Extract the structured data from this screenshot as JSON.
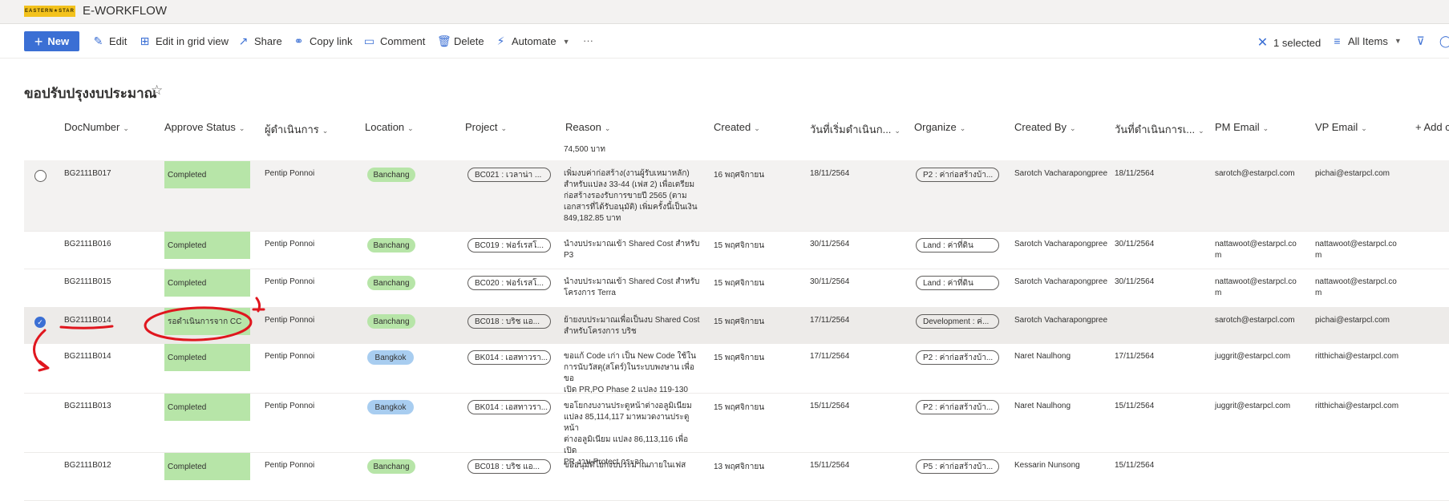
{
  "header": {
    "logo_text": "EASTERN★STAR",
    "app_title": "E-WORKFLOW"
  },
  "command_bar": {
    "new_label": "New",
    "edit_label": "Edit",
    "grid_label": "Edit in grid view",
    "share_label": "Share",
    "copy_link_label": "Copy link",
    "comment_label": "Comment",
    "delete_label": "Delete",
    "automate_label": "Automate",
    "more_label": "···",
    "selected_label": "1 selected",
    "view_label": "All Items"
  },
  "page_title": "ขอปรับปรุงงบประมาณ",
  "columns": [
    "DocNumber",
    "Approve Status",
    "ผู้ดำเนินการ",
    "Location",
    "Project",
    "Reason",
    "Created",
    "วันที่เริ่มดำเนินก...",
    "Organize",
    "Created By",
    "วันที่ดำเนินการเ...",
    "PM Email",
    "VP Email",
    "+ Add c"
  ],
  "top_cut_text": "74,500 บาท",
  "rows": [
    {
      "doc": "BG2111B017",
      "status": "Completed",
      "operator": "Pentip Ponnoi",
      "location": "Banchang",
      "project": "BC021 : เวลาน่า ...",
      "reason": [
        "เพิ่มงบค่าก่อสร้าง(งานผู้รับเหมาหลัก)",
        "สำหรับแปลง 33-44 (เฟส 2) เพื่อเตรียม",
        "ก่อสร้างรองรับการขายปี 2565 (ตาม",
        "เอกสารที่ได้รับอนุมัติ) เพิ่มครั้งนี้เป็นเงิน",
        "849,182.85 บาท"
      ],
      "created": "16 พฤศจิกายน",
      "start_date": "18/11/2564",
      "organize": "P2 : ค่าก่อสร้างบ้า...",
      "created_by": "Sarotch Vacharapongpree",
      "proc_date": "18/11/2564",
      "pm_email": [
        "sarotch@estarpcl.com"
      ],
      "vp_email": [
        "pichai@estarpcl.com"
      ]
    },
    {
      "doc": "BG2111B016",
      "status": "Completed",
      "operator": "Pentip Ponnoi",
      "location": "Banchang",
      "project": "BC019 : ฟอร์เรสโ...",
      "reason": [
        "นำงบประมาณเข้า Shared Cost สำหรับ",
        "P3"
      ],
      "created": "15 พฤศจิกายน",
      "start_date": "30/11/2564",
      "organize": "Land : ค่าที่ดิน",
      "created_by": "Sarotch Vacharapongpree",
      "proc_date": "30/11/2564",
      "pm_email": [
        "nattawoot@estarpcl.co",
        "m"
      ],
      "vp_email": [
        "nattawoot@estarpcl.co",
        "m"
      ]
    },
    {
      "doc": "BG2111B015",
      "status": "Completed",
      "operator": "Pentip Ponnoi",
      "location": "Banchang",
      "project": "BC020 : ฟอร์เรสโ...",
      "reason": [
        "นำงบประมาณเข้า Shared Cost สำหรับ",
        "โครงการ Terra"
      ],
      "created": "15 พฤศจิกายน",
      "start_date": "30/11/2564",
      "organize": "Land : ค่าที่ดิน",
      "created_by": "Sarotch Vacharapongpree",
      "proc_date": "30/11/2564",
      "pm_email": [
        "nattawoot@estarpcl.co",
        "m"
      ],
      "vp_email": [
        "nattawoot@estarpcl.co",
        "m"
      ]
    },
    {
      "doc": "BG2111B014",
      "status": "รอดำเนินการจาก CC",
      "operator": "Pentip Ponnoi",
      "location": "Banchang",
      "project": "BC018 : บริช แอ...",
      "reason": [
        "ย้ายงบประมาณเพื่อเป็นงบ Shared Cost",
        "สำหรับโครงการ บริช"
      ],
      "created": "15 พฤศจิกายน",
      "start_date": "17/11/2564",
      "organize": "Development : ค่...",
      "created_by": "Sarotch Vacharapongpree",
      "proc_date": "",
      "pm_email": [
        "sarotch@estarpcl.com"
      ],
      "vp_email": [
        "pichai@estarpcl.com"
      ]
    },
    {
      "doc": "BG2111B014",
      "status": "Completed",
      "operator": "Pentip Ponnoi",
      "location": "Bangkok",
      "project": "BK014 : เอสทาวรา...",
      "reason": [
        "ขอแก้ Code เก่า เป็น New Code ใช้ใน",
        "การนับวัสดุ(สโตร์)ในระบบพงษาน เพื่อขอ",
        "เปิด PR,PO Phase 2 แปลง 119-130"
      ],
      "created": "15 พฤศจิกายน",
      "start_date": "17/11/2564",
      "organize": "P2 : ค่าก่อสร้างบ้า...",
      "created_by": "Naret Naulhong",
      "proc_date": "17/11/2564",
      "pm_email": [
        "juggrit@estarpcl.com"
      ],
      "vp_email": [
        "ritthichai@estarpcl.com"
      ]
    },
    {
      "doc": "BG2111B013",
      "status": "Completed",
      "operator": "Pentip Ponnoi",
      "location": "Bangkok",
      "project": "BK014 : เอสทาวรา...",
      "reason": [
        "ขอโยกงบงานประตูหน้าต่างอลูมิเนียม",
        "แปลง 85,114,117 มาหมวดงานประตูหน้า",
        "ต่างอลูมิเนียม แปลง 86,113,116 เพื่อเปิด",
        "PR งาน Protect กระจก"
      ],
      "created": "15 พฤศจิกายน",
      "start_date": "15/11/2564",
      "organize": "P2 : ค่าก่อสร้างบ้า...",
      "created_by": "Naret Naulhong",
      "proc_date": "15/11/2564",
      "pm_email": [
        "juggrit@estarpcl.com"
      ],
      "vp_email": [
        "ritthichai@estarpcl.com"
      ]
    },
    {
      "doc": "BG2111B012",
      "status": "Completed",
      "operator": "Pentip Ponnoi",
      "location": "Banchang",
      "project": "BC018 : บริช แอ...",
      "reason": [
        "ขออนุมัติโยกงบประมาณภายในเฟส"
      ],
      "created": "13 พฤศจิกายน",
      "start_date": "15/11/2564",
      "organize": "P5 : ค่าก่อสร้างบ้า...",
      "created_by": "Kessarin Nunsong",
      "proc_date": "15/11/2564",
      "pm_email": [],
      "vp_email": []
    }
  ]
}
